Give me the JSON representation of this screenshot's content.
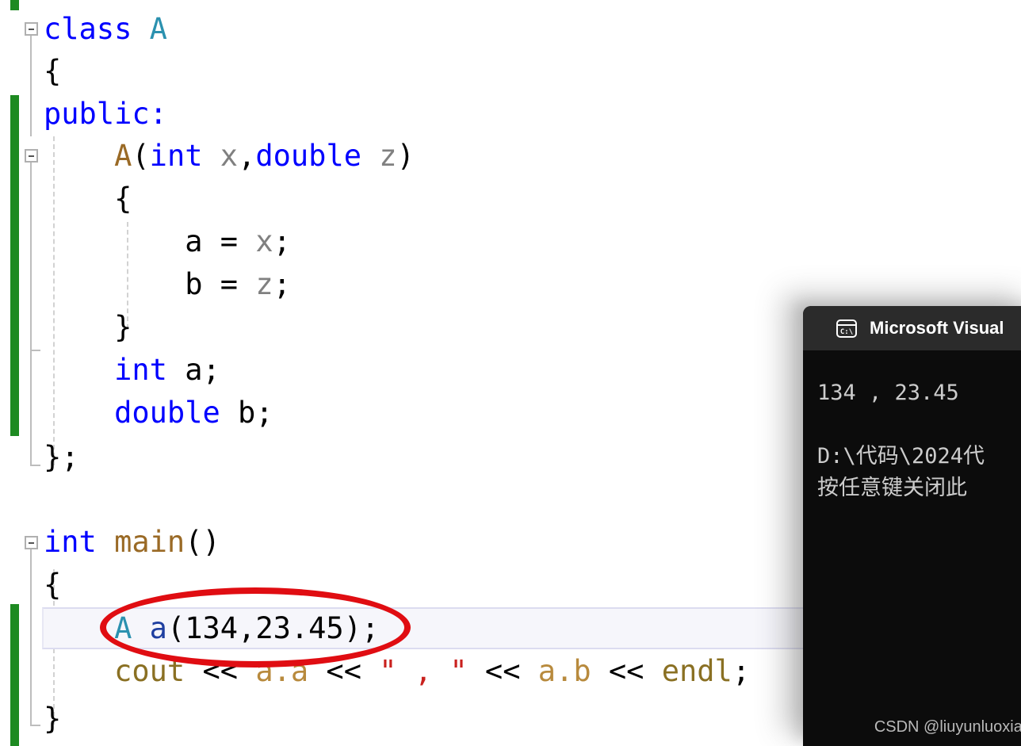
{
  "editor": {
    "language": "cpp",
    "background_color": "#ffffff",
    "change_bar_color": "#1d8a21",
    "current_line_highlight_color": "#f6f6fb",
    "syntax_colors": {
      "keyword": "#0000ff",
      "type": "#2b91af",
      "function": "#9a6a26",
      "parameter": "#808080",
      "member": "#b88a3d",
      "string": "#c9211e",
      "plain": "#000000"
    },
    "lines": [
      {
        "n": 1,
        "text": "class A",
        "tokens": [
          {
            "t": "class",
            "c": "kw"
          },
          {
            "t": " ",
            "c": "plain"
          },
          {
            "t": "A",
            "c": "type"
          }
        ]
      },
      {
        "n": 2,
        "text": "{",
        "tokens": [
          {
            "t": "{",
            "c": "plain"
          }
        ]
      },
      {
        "n": 3,
        "text": "public:",
        "tokens": [
          {
            "t": "public:",
            "c": "kw"
          }
        ]
      },
      {
        "n": 4,
        "text": "    A(int x,double z)",
        "tokens": [
          {
            "t": "    ",
            "c": "plain"
          },
          {
            "t": "A",
            "c": "fn"
          },
          {
            "t": "(",
            "c": "plain"
          },
          {
            "t": "int",
            "c": "kw"
          },
          {
            "t": " ",
            "c": "plain"
          },
          {
            "t": "x",
            "c": "param"
          },
          {
            "t": ",",
            "c": "plain"
          },
          {
            "t": "double",
            "c": "kw"
          },
          {
            "t": " ",
            "c": "plain"
          },
          {
            "t": "z",
            "c": "param"
          },
          {
            "t": ")",
            "c": "plain"
          }
        ]
      },
      {
        "n": 5,
        "text": "    {",
        "tokens": [
          {
            "t": "    {",
            "c": "plain"
          }
        ]
      },
      {
        "n": 6,
        "text": "        a = x;",
        "tokens": [
          {
            "t": "        a = ",
            "c": "plain"
          },
          {
            "t": "x",
            "c": "param"
          },
          {
            "t": ";",
            "c": "plain"
          }
        ]
      },
      {
        "n": 7,
        "text": "        b = z;",
        "tokens": [
          {
            "t": "        b = ",
            "c": "plain"
          },
          {
            "t": "z",
            "c": "param"
          },
          {
            "t": ";",
            "c": "plain"
          }
        ]
      },
      {
        "n": 8,
        "text": "    }",
        "tokens": [
          {
            "t": "    }",
            "c": "plain"
          }
        ]
      },
      {
        "n": 9,
        "text": "    int a;",
        "tokens": [
          {
            "t": "    ",
            "c": "plain"
          },
          {
            "t": "int",
            "c": "kw"
          },
          {
            "t": " a;",
            "c": "plain"
          }
        ]
      },
      {
        "n": 10,
        "text": "    double b;",
        "tokens": [
          {
            "t": "    ",
            "c": "plain"
          },
          {
            "t": "double",
            "c": "kw"
          },
          {
            "t": " b;",
            "c": "plain"
          }
        ]
      },
      {
        "n": 11,
        "text": "};",
        "tokens": [
          {
            "t": "};",
            "c": "plain"
          }
        ]
      },
      {
        "n": 12,
        "text": "",
        "tokens": []
      },
      {
        "n": 13,
        "text": "int main()",
        "tokens": [
          {
            "t": "int",
            "c": "kw"
          },
          {
            "t": " ",
            "c": "plain"
          },
          {
            "t": "main",
            "c": "fn"
          },
          {
            "t": "()",
            "c": "plain"
          }
        ]
      },
      {
        "n": 14,
        "text": "{",
        "tokens": [
          {
            "t": "{",
            "c": "plain"
          }
        ]
      },
      {
        "n": 15,
        "text": "    A a(134,23.45);",
        "tokens": [
          {
            "t": "    ",
            "c": "plain"
          },
          {
            "t": "A",
            "c": "type"
          },
          {
            "t": " ",
            "c": "plain"
          },
          {
            "t": "a",
            "c": "navy"
          },
          {
            "t": "(134,23.45);",
            "c": "plain"
          }
        ]
      },
      {
        "n": 16,
        "text": "    cout << a.a << \" , \" << a.b << endl;",
        "tokens": [
          {
            "t": "    ",
            "c": "plain"
          },
          {
            "t": "cout",
            "c": "libfn"
          },
          {
            "t": " << ",
            "c": "plain"
          },
          {
            "t": "a.a",
            "c": "member"
          },
          {
            "t": " << ",
            "c": "plain"
          },
          {
            "t": "\" , \"",
            "c": "str"
          },
          {
            "t": " << ",
            "c": "plain"
          },
          {
            "t": "a.b",
            "c": "member"
          },
          {
            "t": " << ",
            "c": "plain"
          },
          {
            "t": "endl",
            "c": "libfn"
          },
          {
            "t": ";",
            "c": "plain"
          }
        ]
      },
      {
        "n": 17,
        "text": "}",
        "tokens": [
          {
            "t": "}",
            "c": "plain"
          }
        ]
      }
    ],
    "current_line_number": 15,
    "fold_markers": [
      {
        "for_line": 1,
        "state": "expanded",
        "glyph": "minus-box"
      },
      {
        "for_line": 4,
        "state": "expanded",
        "glyph": "minus-box"
      },
      {
        "for_line": 13,
        "state": "expanded",
        "glyph": "minus-box"
      }
    ]
  },
  "annotation": {
    "shape": "ellipse",
    "color": "#e00d12",
    "targets_line": 15,
    "target_text": "A a(134,23.45);"
  },
  "console": {
    "title": "Microsoft Visual",
    "icon": "console-cmd-icon",
    "titlebar_color": "#2b2b2b",
    "body_color": "#0c0c0c",
    "text_color": "#cccccc",
    "lines": [
      "134 , 23.45",
      "",
      "D:\\代码\\2024代",
      "按任意键关闭此"
    ]
  },
  "watermark": {
    "text": "CSDN @liuyunluoxiao"
  }
}
